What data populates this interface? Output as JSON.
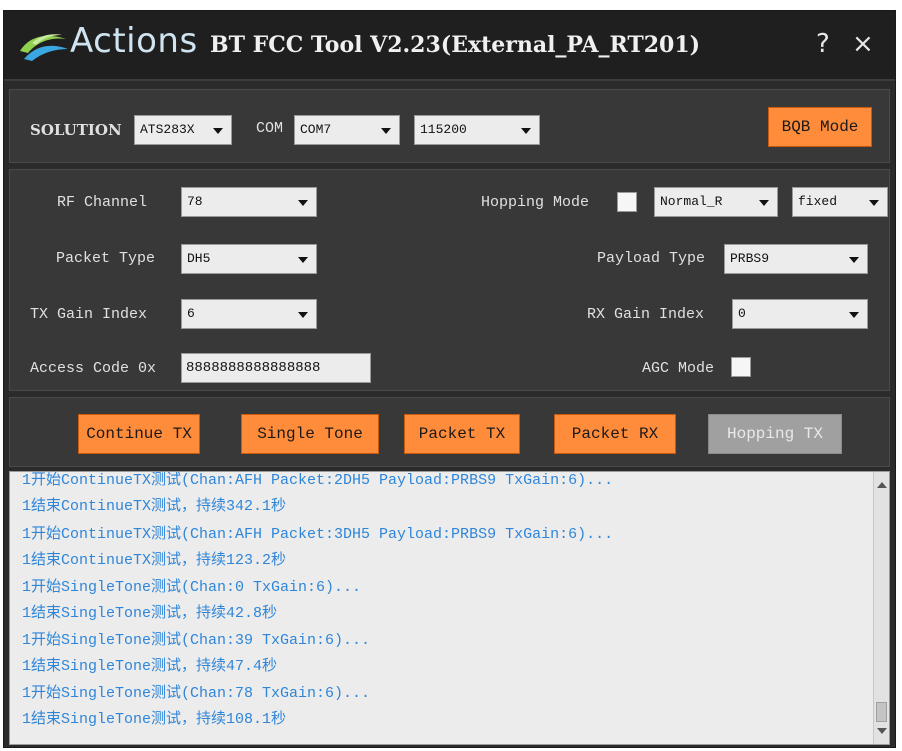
{
  "window": {
    "brand": "Actions",
    "title": "BT FCC Tool V2.23(External_PA_RT201)",
    "help_label": "?",
    "close_label": "×"
  },
  "solution_row": {
    "solution_label": "SOLUTION",
    "solution_value": "ATS283X",
    "com_label": "COM",
    "com_value": "COM7",
    "baud_value": "115200",
    "bqb_button": "BQB Mode"
  },
  "settings": {
    "rf_channel_label": "RF Channel",
    "rf_channel_value": "78",
    "hopping_mode_label": "Hopping Mode",
    "hopping_mode_checked": false,
    "hopping_type_value": "Normal_R",
    "hopping_fixed_value": "fixed",
    "packet_type_label": "Packet Type",
    "packet_type_value": "DH5",
    "payload_type_label": "Payload Type",
    "payload_type_value": "PRBS9",
    "tx_gain_label": "TX Gain Index",
    "tx_gain_value": "6",
    "rx_gain_label": "RX Gain Index",
    "rx_gain_value": "0",
    "access_code_label": "Access Code 0x",
    "access_code_value": "8888888888888888",
    "agc_mode_label": "AGC Mode",
    "agc_mode_checked": false
  },
  "actions": {
    "continue_tx": "Continue TX",
    "single_tone": "Single Tone",
    "packet_tx": "Packet TX",
    "packet_rx": "Packet RX",
    "hopping_tx": "Hopping TX"
  },
  "log": {
    "lines": [
      "1开始ContinueTX测试(Chan:AFH Packet:2DH5 Payload:PRBS9 TxGain:6)...",
      "1结束ContinueTX测试，持续342.1秒",
      "1开始ContinueTX测试(Chan:AFH Packet:3DH5 Payload:PRBS9 TxGain:6)...",
      "1结束ContinueTX测试，持续123.2秒",
      "1开始SingleTone测试(Chan:0 TxGain:6)...",
      "1结束SingleTone测试，持续42.8秒",
      "1开始SingleTone测试(Chan:39 TxGain:6)...",
      "1结束SingleTone测试，持续47.4秒",
      "1开始SingleTone测试(Chan:78 TxGain:6)...",
      "1结束SingleTone测试，持续108.1秒"
    ]
  },
  "colors": {
    "accent_orange": "#ff8c3a",
    "log_text": "#2f86d9",
    "window_bg": "#2b2b2b",
    "panel_bg": "#383838"
  }
}
